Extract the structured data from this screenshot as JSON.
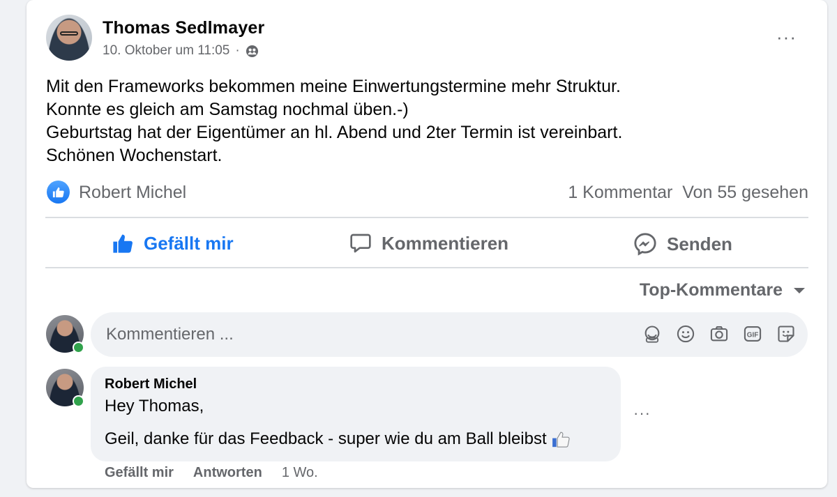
{
  "post": {
    "author": "Thomas Sedlmayer",
    "timestamp": "10. Oktober um 11:05",
    "separator": "·",
    "lines": [
      "Mit den Frameworks bekommen meine Einwertungstermine mehr Struktur.",
      "Konnte es gleich am Samstag nochmal üben.-)",
      "Geburtstag hat der Eigentümer an hl. Abend und 2ter Termin ist vereinbart.",
      "Schönen Wochenstart."
    ],
    "more": "···"
  },
  "reactions": {
    "reactor": "Robert Michel",
    "stats": "1 Kommentar  Von 55 gesehen"
  },
  "actions": {
    "like": "Gefällt mir",
    "comment": "Kommentieren",
    "send": "Senden"
  },
  "filter": {
    "label": "Top-Kommentare"
  },
  "composer": {
    "placeholder": "Kommentieren ..."
  },
  "comment": {
    "author": "Robert Michel",
    "line1": "Hey Thomas,",
    "line2": "Geil, danke für das Feedback - super wie du am Ball bleibst",
    "more": "···",
    "like": "Gefällt mir",
    "reply": "Antworten",
    "age": "1 Wo."
  },
  "colors": {
    "accent": "#1877f2",
    "muted": "#65676b",
    "online": "#31a24c"
  }
}
